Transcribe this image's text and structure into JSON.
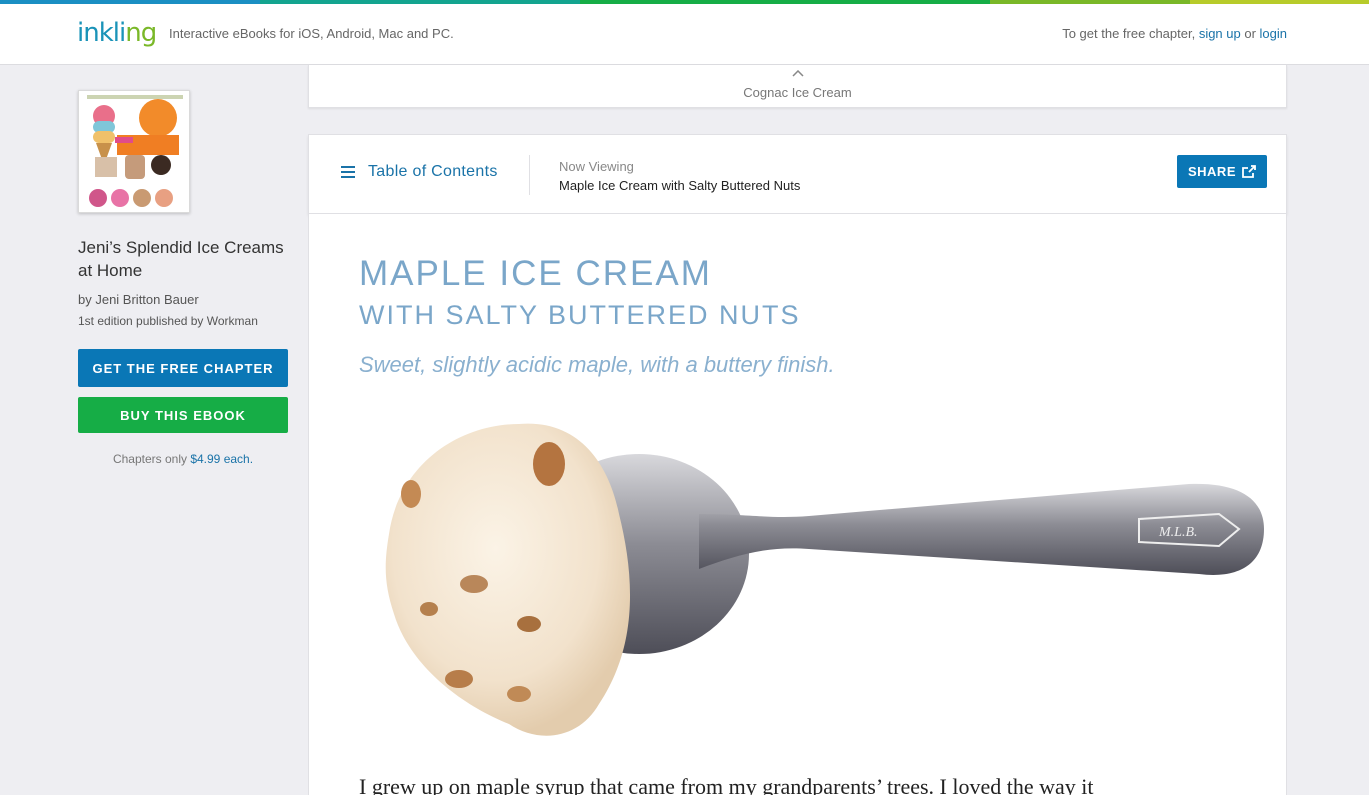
{
  "header": {
    "logo_text": "inkling",
    "logo_text_main": "inkli",
    "logo_text_accent": "ng",
    "tagline": "Interactive eBooks for iOS, Android, Mac and PC.",
    "cta_prefix": "To get the free chapter, ",
    "sign_up_label": "sign up",
    "or_text": " or ",
    "login_label": "login",
    "strip_colors": [
      "#1a8fc3",
      "#13a48f",
      "#16ad46",
      "#7ab828",
      "#b7cb2a"
    ]
  },
  "sidebar": {
    "book_title": "Jeni’s Splendid Ice Creams at Home",
    "author": "by Jeni Britton Bauer",
    "edition": "1st edition published by Workman",
    "free_chapter_button": "GET THE FREE CHAPTER",
    "buy_button": "BUY THIS EBOOK",
    "price_prefix": "Chapters only ",
    "price_link": "$4.99 each."
  },
  "previous_chapter": {
    "caret": "^",
    "label": "Cognac Ice Cream"
  },
  "toolbar": {
    "toc_label": "Table of Contents",
    "now_viewing_label": "Now Viewing",
    "now_viewing_title": "Maple Ice Cream with Salty Buttered Nuts",
    "share_label": "SHARE"
  },
  "article": {
    "heading_line1": "MAPLE ICE CREAM",
    "heading_line2": "WITH SALTY BUTTERED NUTS",
    "subtitle": "Sweet, slightly acidic maple, with a buttery finish.",
    "engraving": "M.L.B.",
    "body_start": "I grew up on maple syrup that came from my grandparents’ trees. I loved the way it"
  },
  "colors": {
    "link_blue": "#1a73a8",
    "primary_button": "#0a77b6",
    "buy_button": "#16ad46",
    "heading_blue": "#7aa6c9"
  }
}
